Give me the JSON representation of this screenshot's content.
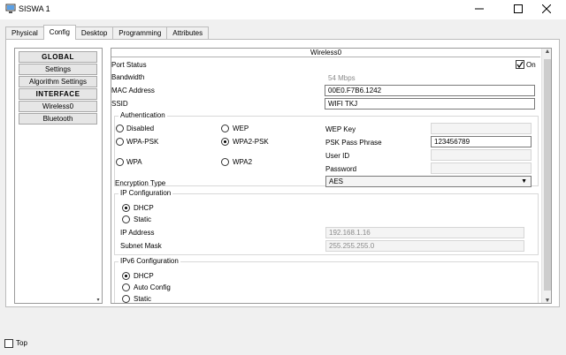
{
  "window": {
    "title": "SISWA 1"
  },
  "tabs": [
    "Physical",
    "Config",
    "Desktop",
    "Programming",
    "Attributes"
  ],
  "nav": {
    "items": [
      {
        "label": "GLOBAL",
        "group": true
      },
      {
        "label": "Settings",
        "group": false
      },
      {
        "label": "Algorithm Settings",
        "group": false
      },
      {
        "label": "INTERFACE",
        "group": true
      },
      {
        "label": "Wireless0",
        "group": false
      },
      {
        "label": "Bluetooth",
        "group": false
      }
    ]
  },
  "main": {
    "header": "Wireless0",
    "port_status": {
      "label": "Port Status",
      "on_label": "On",
      "checked": true
    },
    "bandwidth": {
      "label": "Bandwidth",
      "value": "54 Mbps"
    },
    "mac": {
      "label": "MAC Address",
      "value": "00E0.F7B6.1242"
    },
    "ssid": {
      "label": "SSID",
      "value": "WIFI TKJ"
    },
    "auth": {
      "title": "Authentication",
      "options": [
        {
          "label": "Disabled",
          "selected": false
        },
        {
          "label": "WEP",
          "selected": false
        },
        {
          "label": "WPA-PSK",
          "selected": false
        },
        {
          "label": "WPA2-PSK",
          "selected": true
        },
        {
          "label": "WPA",
          "selected": false
        },
        {
          "label": "WPA2",
          "selected": false
        }
      ],
      "wep_key": {
        "label": "WEP Key",
        "value": ""
      },
      "psk": {
        "label": "PSK Pass Phrase",
        "value": "123456789"
      },
      "user_id": {
        "label": "User ID",
        "value": ""
      },
      "password": {
        "label": "Password",
        "value": ""
      }
    },
    "encryption": {
      "label": "Encryption Type",
      "value": "AES"
    },
    "ip_config": {
      "title": "IP Configuration",
      "dhcp": "DHCP",
      "static": "Static",
      "ip_label": "IP Address",
      "ip_value": "192.168.1.16",
      "mask_label": "Subnet Mask",
      "mask_value": "255.255.255.0"
    },
    "ipv6_config": {
      "title": "IPv6 Configuration",
      "dhcp": "DHCP",
      "auto": "Auto Config",
      "static": "Static"
    }
  },
  "footer": {
    "top_label": "Top"
  }
}
